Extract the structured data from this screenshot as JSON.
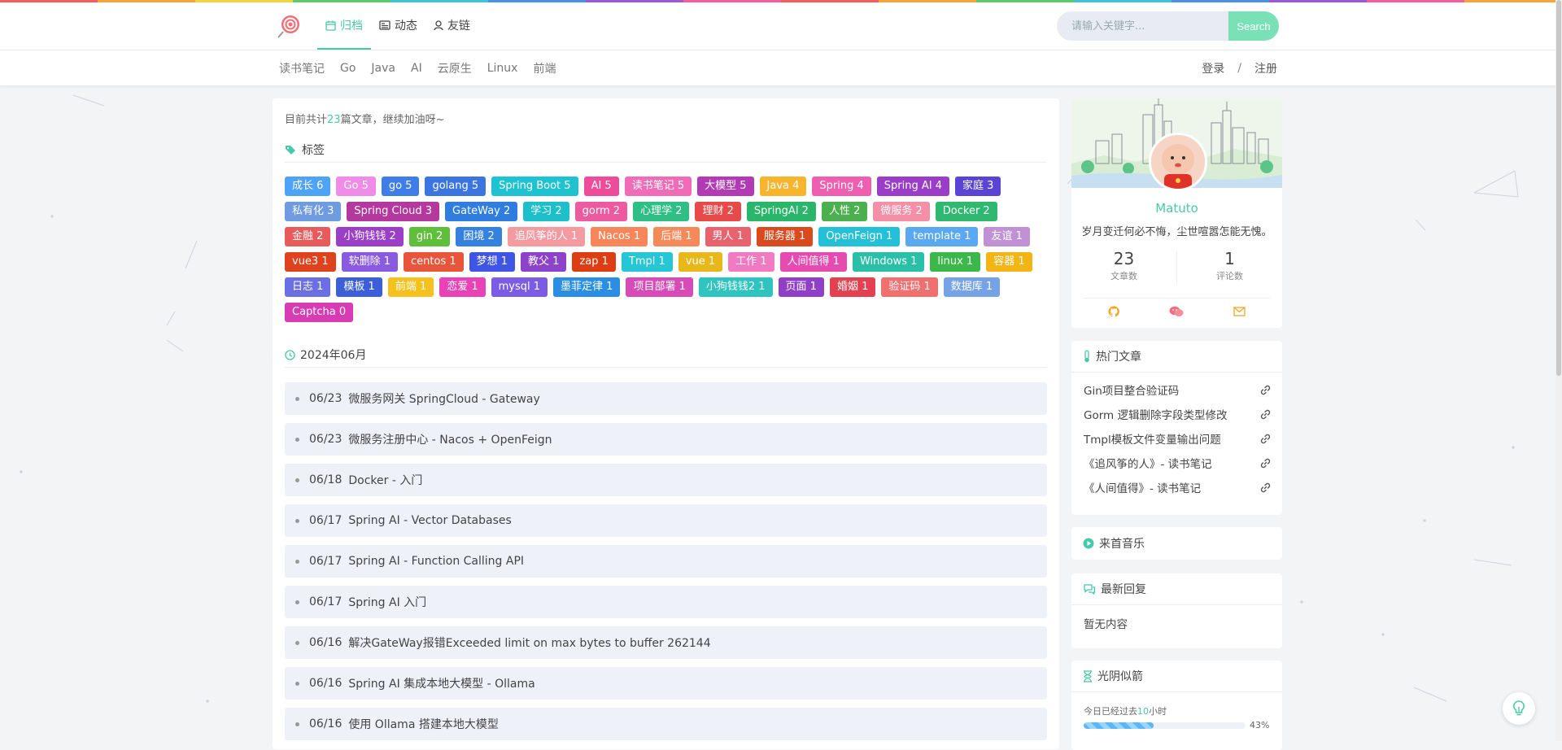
{
  "nav": {
    "items": [
      {
        "label": "归档",
        "icon": "calendar-icon",
        "active": true
      },
      {
        "label": "动态",
        "icon": "news-icon",
        "active": false
      },
      {
        "label": "友链",
        "icon": "user-icon",
        "active": false
      }
    ]
  },
  "search": {
    "placeholder": "请输入关键字...",
    "button_label": "Search"
  },
  "categories": [
    "读书笔记",
    "Go",
    "Java",
    "AI",
    "云原生",
    "Linux",
    "前端"
  ],
  "auth": {
    "login": "登录",
    "separator": "/",
    "register": "注册"
  },
  "summary": {
    "prefix": "目前共计",
    "count": "23",
    "suffix": "篇文章，继续加油呀~"
  },
  "tags_section": {
    "title": "标签"
  },
  "tags": [
    {
      "label": "成长 6",
      "color": "#4da3f7"
    },
    {
      "label": "Go 5",
      "color": "#f08be8"
    },
    {
      "label": "go 5",
      "color": "#3f7ee8"
    },
    {
      "label": "golang 5",
      "color": "#3b76e0"
    },
    {
      "label": "Spring Boot 5",
      "color": "#1fc2d0"
    },
    {
      "label": "AI 5",
      "color": "#ee4b9a"
    },
    {
      "label": "读书笔记 5",
      "color": "#f06cb8"
    },
    {
      "label": "大模型 5",
      "color": "#b23bb5"
    },
    {
      "label": "Java 4",
      "color": "#f7b52d"
    },
    {
      "label": "Spring 4",
      "color": "#ee5fb2"
    },
    {
      "label": "Spring AI 4",
      "color": "#9a3ec8"
    },
    {
      "label": "家庭 3",
      "color": "#5b43d6"
    },
    {
      "label": "私有化 3",
      "color": "#6f9be0"
    },
    {
      "label": "Spring Cloud 3",
      "color": "#b5389f"
    },
    {
      "label": "GateWay 2",
      "color": "#2f7de0"
    },
    {
      "label": "学习 2",
      "color": "#1cbfca"
    },
    {
      "label": "gorm 2",
      "color": "#ee5a9f"
    },
    {
      "label": "心理学 2",
      "color": "#2fbf84"
    },
    {
      "label": "理财 2",
      "color": "#e84a4a"
    },
    {
      "label": "SpringAI 2",
      "color": "#29b56a"
    },
    {
      "label": "人性 2",
      "color": "#4caf50"
    },
    {
      "label": "微服务 2",
      "color": "#f58fa8"
    },
    {
      "label": "Docker 2",
      "color": "#2eb870"
    },
    {
      "label": "金融 2",
      "color": "#e85b5b"
    },
    {
      "label": "小狗钱钱 2",
      "color": "#9b3fc6"
    },
    {
      "label": "gin 2",
      "color": "#5fbf3a"
    },
    {
      "label": "困境 2",
      "color": "#3481e0"
    },
    {
      "label": "追风筝的人 1",
      "color": "#f59aa0"
    },
    {
      "label": "Nacos 1",
      "color": "#f7875a"
    },
    {
      "label": "后端 1",
      "color": "#f48a5a"
    },
    {
      "label": "男人 1",
      "color": "#e8636e"
    },
    {
      "label": "服务器 1",
      "color": "#d94a1e"
    },
    {
      "label": "OpenFeign 1",
      "color": "#23c0d8"
    },
    {
      "label": "template 1",
      "color": "#5aa8f0"
    },
    {
      "label": "友谊 1",
      "color": "#c091d4"
    },
    {
      "label": "vue3 1",
      "color": "#e0421d"
    },
    {
      "label": "软删除 1",
      "color": "#8a5be0"
    },
    {
      "label": "centos 1",
      "color": "#e8553a"
    },
    {
      "label": "梦想 1",
      "color": "#3e55e6"
    },
    {
      "label": "教父 1",
      "color": "#8d43c9"
    },
    {
      "label": "zap 1",
      "color": "#de3d13"
    },
    {
      "label": "Tmpl 1",
      "color": "#25c6d6"
    },
    {
      "label": "vue 1",
      "color": "#e8b71a"
    },
    {
      "label": "工作 1",
      "color": "#f27ac2"
    },
    {
      "label": "人间值得 1",
      "color": "#e84bb0"
    },
    {
      "label": "Windows 1",
      "color": "#2ac0a8"
    },
    {
      "label": "linux 1",
      "color": "#3cb84a"
    },
    {
      "label": "容器 1",
      "color": "#f2b515"
    },
    {
      "label": "日志 1",
      "color": "#6b6fe2"
    },
    {
      "label": "模板 1",
      "color": "#3c5ed8"
    },
    {
      "label": "前端 1",
      "color": "#f6c11d"
    },
    {
      "label": "恋爱 1",
      "color": "#e942b6"
    },
    {
      "label": "mysql 1",
      "color": "#7b5ce4"
    },
    {
      "label": "墨菲定律 1",
      "color": "#2a8fe4"
    },
    {
      "label": "项目部署 1",
      "color": "#d74bb8"
    },
    {
      "label": "小狗钱钱2 1",
      "color": "#2fc4c0"
    },
    {
      "label": "页面 1",
      "color": "#9040c6"
    },
    {
      "label": "婚姻 1",
      "color": "#e34050"
    },
    {
      "label": "验证码 1",
      "color": "#f06f6f"
    },
    {
      "label": "数据库 1",
      "color": "#75a3e6"
    },
    {
      "label": "Captcha 0",
      "color": "#d83cb4"
    }
  ],
  "archive": {
    "month": "2024年06月",
    "posts": [
      {
        "date": "06/23",
        "title": "微服务网关 SpringCloud - Gateway"
      },
      {
        "date": "06/23",
        "title": "微服务注册中心 - Nacos + OpenFeign"
      },
      {
        "date": "06/18",
        "title": "Docker - 入门"
      },
      {
        "date": "06/17",
        "title": "Spring AI - Vector Databases"
      },
      {
        "date": "06/17",
        "title": "Spring AI - Function Calling API"
      },
      {
        "date": "06/17",
        "title": "Spring AI 入门"
      },
      {
        "date": "06/16",
        "title": "解决GateWay报错Exceeded limit on max bytes to buffer 262144"
      },
      {
        "date": "06/16",
        "title": "Spring AI 集成本地大模型 - Ollama"
      },
      {
        "date": "06/16",
        "title": "使用 Ollama 搭建本地大模型"
      }
    ]
  },
  "profile": {
    "name": "Matuto",
    "motto": "岁月变迁何必不悔，尘世喧嚣怎能无愧。",
    "article_count": "23",
    "article_label": "文章数",
    "comment_count": "1",
    "comment_label": "评论数",
    "social_icons": [
      "github-icon",
      "wechat-icon",
      "mail-icon"
    ]
  },
  "hot": {
    "title": "热门文章",
    "items": [
      "Gin项目整合验证码",
      "Gorm 逻辑删除字段类型修改",
      "Tmpl模板文件变量输出问题",
      "《追风筝的人》- 读书笔记",
      "《人间值得》- 读书笔记"
    ]
  },
  "music": {
    "title": "来首音乐"
  },
  "replies": {
    "title": "最新回复",
    "empty": "暂无内容"
  },
  "time": {
    "title": "光阴似箭",
    "prefix": "今日已经过去",
    "hours": "10",
    "suffix": "小时",
    "percent": 43,
    "percent_label": "43%"
  },
  "colors": {
    "accent": "#48c9a9",
    "search_button": "#7ae0b6"
  }
}
